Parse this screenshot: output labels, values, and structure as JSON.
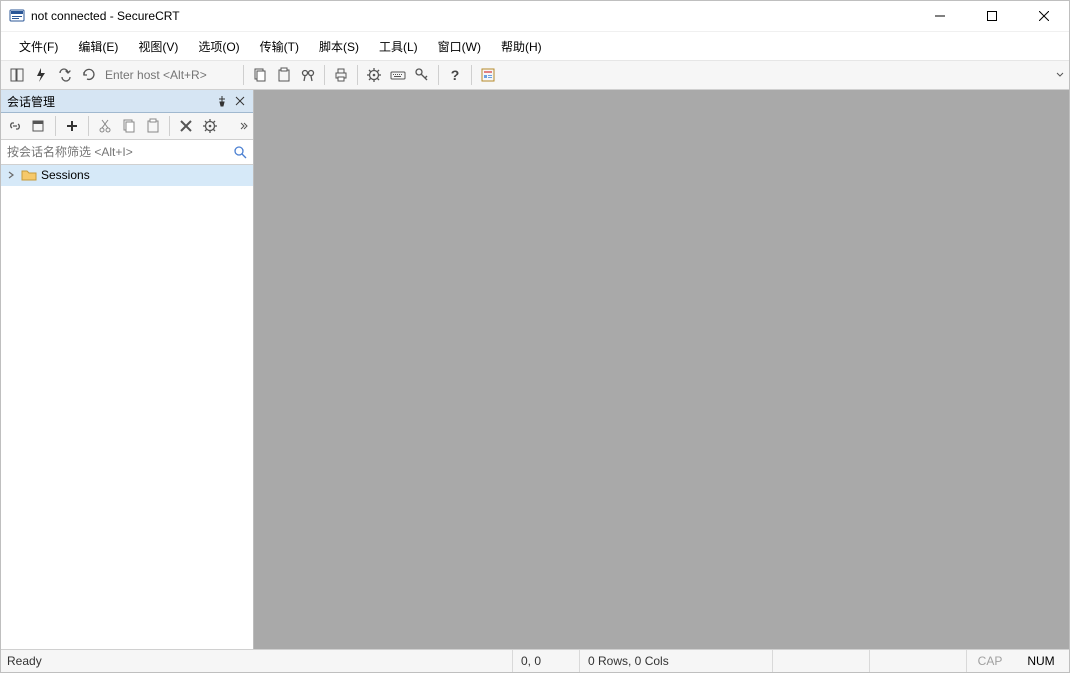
{
  "title": "not connected - SecureCRT",
  "menus": [
    "文件(F)",
    "编辑(E)",
    "视图(V)",
    "选项(O)",
    "传输(T)",
    "脚本(S)",
    "工具(L)",
    "窗口(W)",
    "帮助(H)"
  ],
  "host_placeholder": "Enter host <Alt+R>",
  "sidebar": {
    "title": "会话管理",
    "filter_placeholder": "按会话名称筛选 <Alt+I>",
    "tree": {
      "root_label": "Sessions"
    }
  },
  "status": {
    "ready": "Ready",
    "pos": "0, 0",
    "rows": "0 Rows, 0 Cols",
    "cap": "CAP",
    "num": "NUM"
  }
}
